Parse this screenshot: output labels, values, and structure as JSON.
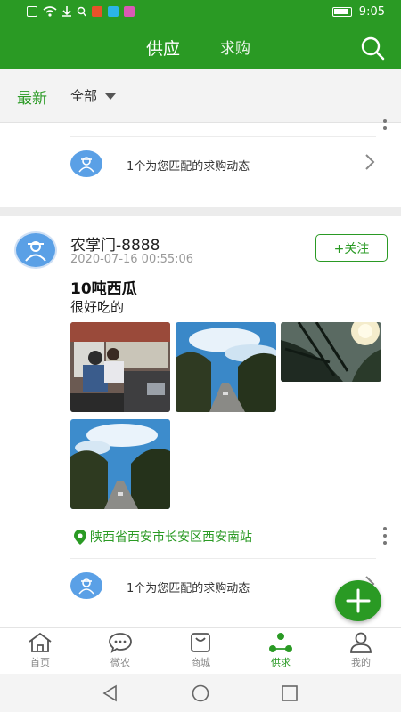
{
  "status_bar": {
    "time": "9:05",
    "icons": [
      "sim-icon",
      "wifi-icon",
      "download-icon",
      "search-notify-icon",
      "app-badge-icon",
      "app-badge-icon",
      "app-badge-icon"
    ]
  },
  "top_tabs": {
    "supply": "供应",
    "demand": "求购"
  },
  "filter": {
    "latest": "最新",
    "all": "全部"
  },
  "match_text": "1个为您匹配的求购动态",
  "post": {
    "username": "农掌门-8888",
    "timestamp": "2020-07-16 00:55:06",
    "follow": "+关注",
    "title": "10吨西瓜",
    "description": "很好吃的",
    "location": "陕西省西安市长安区西安南站"
  },
  "nav": {
    "home": "首页",
    "wechat": "微农",
    "mall": "商城",
    "supply_demand": "供求",
    "mine": "我的"
  },
  "colors": {
    "brand_green": "#2a9a24",
    "avatar_blue": "#5aa0e6"
  }
}
